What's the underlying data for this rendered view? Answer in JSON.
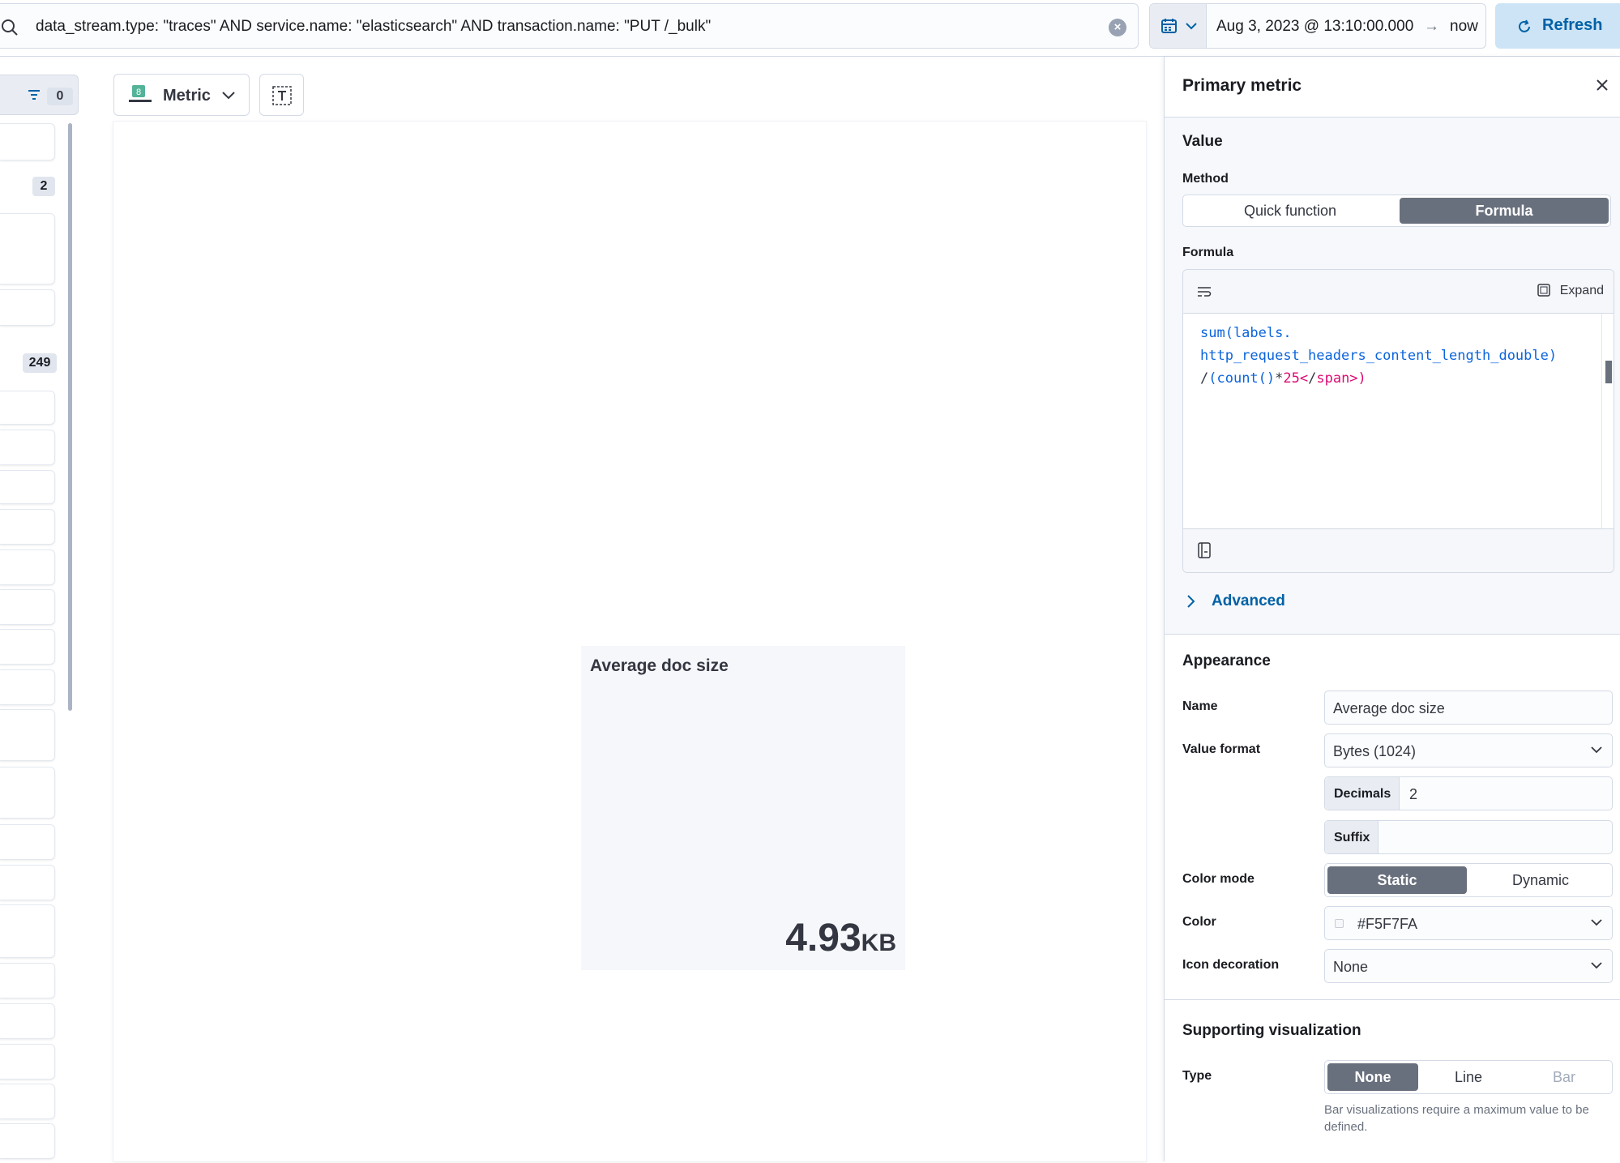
{
  "query": {
    "text": "data_stream.type: \"traces\" AND service.name: \"elasticsearch\" AND transaction.name: \"PUT /_bulk\"",
    "clear_icon": "clear-icon",
    "search_icon": "search-icon"
  },
  "date_picker": {
    "start": "Aug 3, 2023 @ 13:10:00.000",
    "arrow": "→",
    "end": "now",
    "quick_menu_icon": "calendar-icon"
  },
  "refresh": {
    "label": "Refresh",
    "icon": "refresh-icon"
  },
  "sidebar": {
    "filter_count": "0",
    "badges": [
      "2",
      "249"
    ]
  },
  "workspace": {
    "chart_type_label": "Metric",
    "chart_type_icon": "metric-icon",
    "metric": {
      "title": "Average doc size",
      "value": "4.93",
      "unit": "KB",
      "background": "#F5F7FA"
    }
  },
  "flyout": {
    "title": "Primary metric",
    "value_section": {
      "title": "Value",
      "method_label": "Method",
      "methods": [
        "Quick function",
        "Formula"
      ],
      "selected_method": "Formula",
      "formula_label": "Formula",
      "expand_label": "Expand",
      "formula_lines": [
        "sum(labels.",
        "http_request_headers_content_length_double)",
        "/(count()*25)"
      ],
      "advanced_label": "Advanced"
    },
    "appearance": {
      "title": "Appearance",
      "name_label": "Name",
      "name_value": "Average doc size",
      "value_format_label": "Value format",
      "value_format": "Bytes (1024)",
      "decimals_label": "Decimals",
      "decimals_value": "2",
      "suffix_label": "Suffix",
      "suffix_value": "",
      "color_mode_label": "Color mode",
      "color_modes": [
        "Static",
        "Dynamic"
      ],
      "selected_color_mode": "Static",
      "color_label": "Color",
      "color_value": "#F5F7FA",
      "icon_decoration_label": "Icon decoration",
      "icon_decoration_value": "None"
    },
    "supporting_visualization": {
      "title": "Supporting visualization",
      "type_label": "Type",
      "types": [
        "None",
        "Line",
        "Bar"
      ],
      "selected_type": "None",
      "help_text": "Bar visualizations require a maximum value to be defined."
    }
  },
  "colors": {
    "accent": "#0061a6",
    "selected_segment": "#69707d",
    "formula_function": "#0b64dd",
    "formula_number": "#dd0a73"
  }
}
